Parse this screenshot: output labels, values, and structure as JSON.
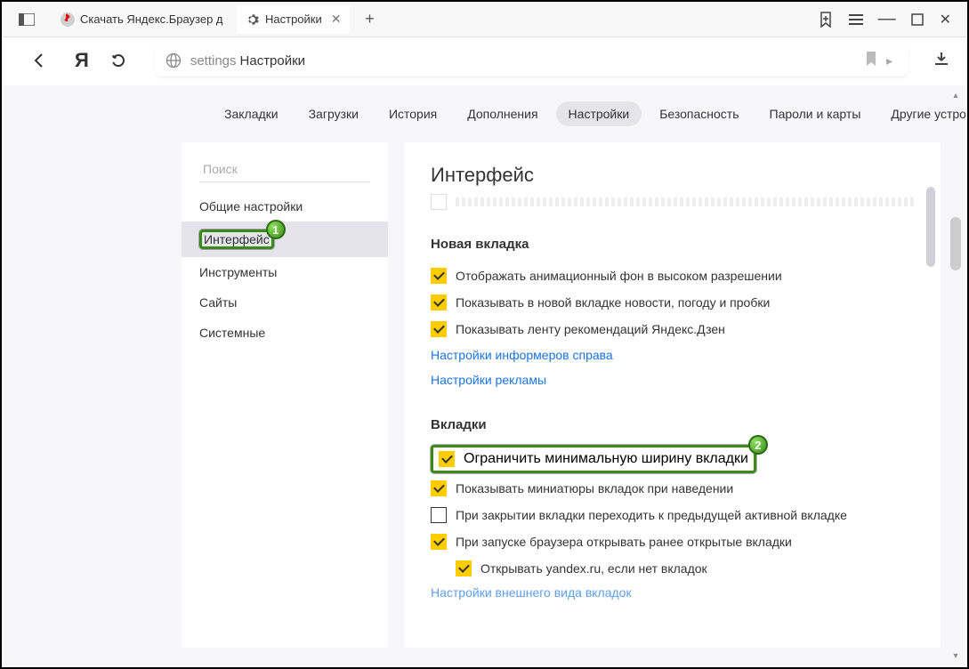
{
  "titlebar": {
    "tabs": [
      {
        "title": "Скачать Яндекс.Браузер д",
        "active": false
      },
      {
        "title": "Настройки",
        "active": true
      }
    ]
  },
  "addressbar": {
    "home_label": "Я",
    "protocol": "settings",
    "path": "Настройки"
  },
  "topnav": {
    "items": [
      "Закладки",
      "Загрузки",
      "История",
      "Дополнения",
      "Настройки",
      "Безопасность",
      "Пароли и карты",
      "Другие устройс"
    ],
    "active_index": 4
  },
  "sidebar": {
    "search_placeholder": "Поиск",
    "items": [
      "Общие настройки",
      "Интерфейс",
      "Инструменты",
      "Сайты",
      "Системные"
    ],
    "selected_index": 1
  },
  "callouts": {
    "sidebar": "1",
    "checkbox": "2"
  },
  "panel": {
    "title": "Интерфейс",
    "section_new_tab": {
      "heading": "Новая вкладка",
      "checks": [
        {
          "label": "Отображать анимационный фон в высоком разрешении",
          "checked": true
        },
        {
          "label": "Показывать в новой вкладке новости, погоду и пробки",
          "checked": true
        },
        {
          "label": "Показывать ленту рекомендаций Яндекс.Дзен",
          "checked": true
        }
      ],
      "links": [
        "Настройки информеров справа",
        "Настройки рекламы"
      ]
    },
    "section_tabs": {
      "heading": "Вкладки",
      "checks": [
        {
          "label": "Ограничить минимальную ширину вкладки",
          "checked": true,
          "highlighted": true
        },
        {
          "label": "Показывать миниатюры вкладок при наведении",
          "checked": true
        },
        {
          "label": "При закрытии вкладки переходить к предыдущей активной вкладке",
          "checked": false
        },
        {
          "label": "При запуске браузера открывать ранее открытые вкладки",
          "checked": true
        },
        {
          "label": "Открывать yandex.ru, если нет вкладок",
          "checked": true,
          "indent": true
        }
      ],
      "cutoff_link": "Настройки внешнего вида вкладок"
    }
  }
}
